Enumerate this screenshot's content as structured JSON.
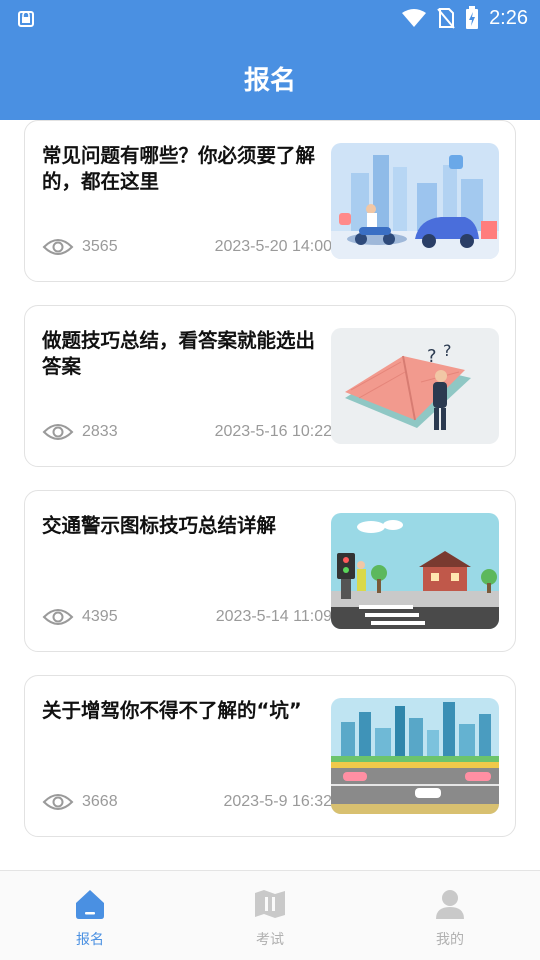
{
  "status_bar": {
    "time": "2:26"
  },
  "header": {
    "title": "报名"
  },
  "articles": [
    {
      "title": "常见问题有哪些？你必须要了解的，都在这里",
      "views": "3565",
      "date": "2023-5-20 14:00",
      "thumb_icon": "city-traffic-illustration"
    },
    {
      "title": "做题技巧总结，看答案就能选出答案",
      "views": "2833",
      "date": "2023-5-16 10:22",
      "thumb_icon": "book-thinking-illustration"
    },
    {
      "title": "交通警示图标技巧总结详解",
      "views": "4395",
      "date": "2023-5-14 11:09",
      "thumb_icon": "crosswalk-illustration"
    },
    {
      "title": "关于增驾你不得不了解的“坑”",
      "views": "3668",
      "date": "2023-5-9 16:32",
      "thumb_icon": "city-road-illustration"
    }
  ],
  "nav": [
    {
      "label": "报名",
      "icon": "home-icon",
      "active": true
    },
    {
      "label": "考试",
      "icon": "map-icon",
      "active": false
    },
    {
      "label": "我的",
      "icon": "user-icon",
      "active": false
    }
  ],
  "colors": {
    "primary": "#4a90e2",
    "muted": "#9a9a9a",
    "nav_inactive": "#b0b0b0"
  }
}
